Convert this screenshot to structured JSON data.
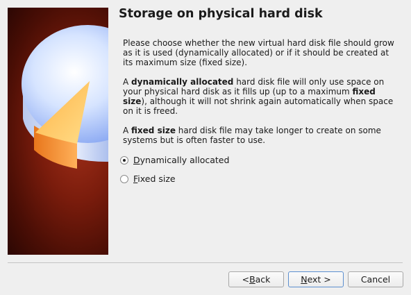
{
  "wizard": {
    "title": "Storage on physical hard disk",
    "paragraph1": "Please choose whether the new virtual hard disk file should grow as it is used (dynamically allocated) or if it should be created at its maximum size (fixed size).",
    "paragraph2": {
      "prefix": "A ",
      "bold1": "dynamically allocated",
      "mid": " hard disk file will only use space on your physical hard disk as it fills up (up to a maximum ",
      "bold2": "fixed size",
      "suffix": "), although it will not shrink again automatically when space on it is freed."
    },
    "paragraph3": {
      "prefix": "A ",
      "bold": "fixed size",
      "suffix": " hard disk file may take longer to create on some systems but is often faster to use."
    },
    "options": [
      {
        "mnemonic": "D",
        "rest": "ynamically allocated",
        "checked": true
      },
      {
        "mnemonic": "F",
        "rest": "ixed size",
        "checked": false
      }
    ]
  },
  "buttons": {
    "back": {
      "pre": "< ",
      "mnemonic": "B",
      "rest": "ack"
    },
    "next": {
      "mnemonic": "N",
      "rest": "ext >"
    },
    "cancel": "Cancel"
  },
  "banner": {
    "icon": "hard-disk-pie-icon"
  }
}
